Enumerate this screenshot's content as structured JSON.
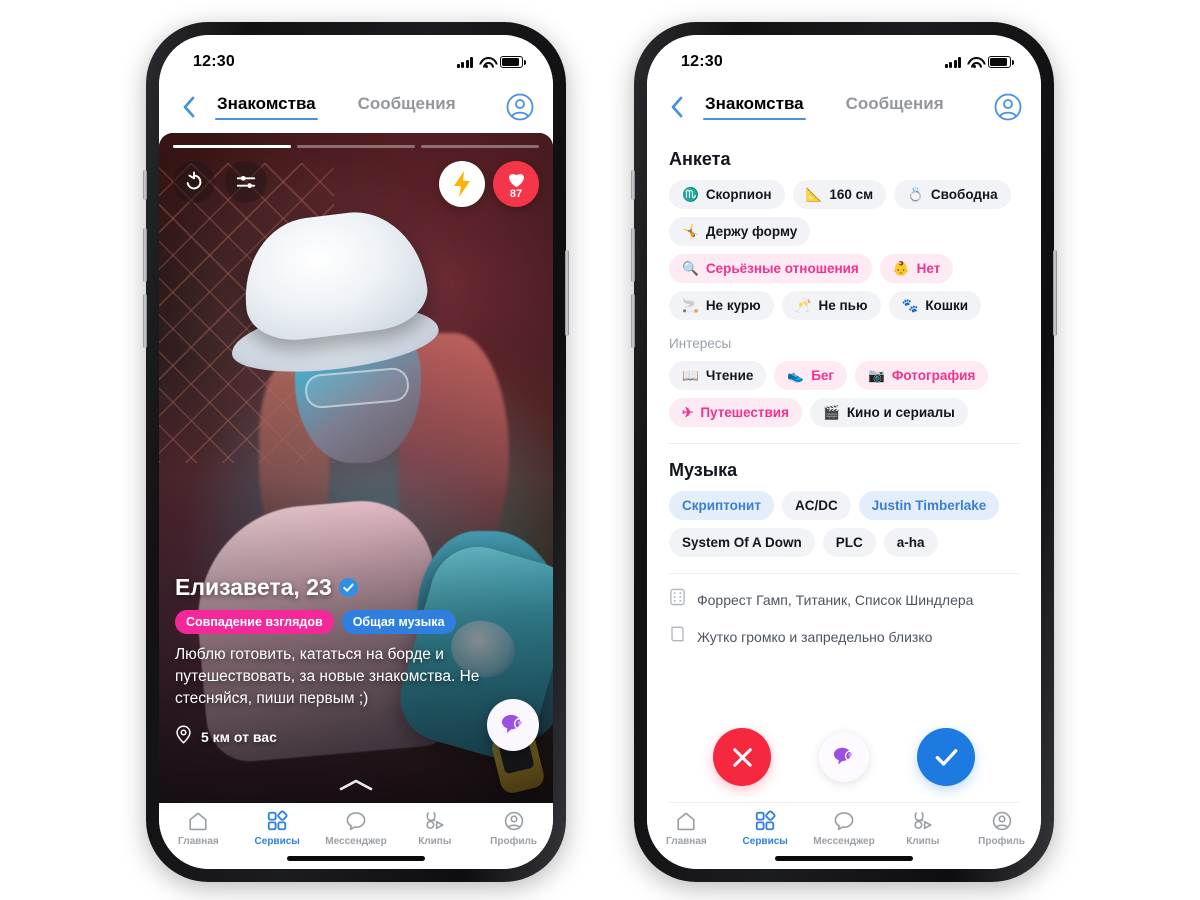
{
  "status": {
    "time": "12:30",
    "signal_icon": "cellular-signal-icon",
    "wifi_icon": "wifi-icon",
    "battery_icon": "battery-icon"
  },
  "nav": {
    "back_icon": "back-chevron-icon",
    "tab_dating": "Знакомства",
    "tab_messages": "Сообщения",
    "profile_icon": "account-circle-icon"
  },
  "card": {
    "progress_total": 3,
    "progress_active": 1,
    "rewind_icon": "rewind-arrow-icon",
    "filters_icon": "sliders-icon",
    "boost_icon": "lightning-bolt-icon",
    "likes_icon": "heart-icon",
    "likes_count": "87",
    "name": "Елизавета, 23",
    "verified_icon": "verified-check-icon",
    "badge_views": "Совпадение взглядов",
    "badge_music": "Общая музыка",
    "bio": "Люблю готовить, кататься на борде и путешествовать, за новые знакомства. Не стесняйся, пиши первым ;)",
    "location_icon": "location-pin-icon",
    "distance": "5 км от вас",
    "chat_fab_icon": "chat-heart-icon",
    "expand_icon": "chevron-up-icon"
  },
  "tabbar": {
    "items": [
      {
        "label": "Главная",
        "icon": "home-icon",
        "active": false
      },
      {
        "label": "Сервисы",
        "icon": "services-icon",
        "active": true
      },
      {
        "label": "Мессенджер",
        "icon": "chat-bubble-icon",
        "active": false
      },
      {
        "label": "Клипы",
        "icon": "clips-icon",
        "active": false
      },
      {
        "label": "Профиль",
        "icon": "profile-icon",
        "active": false
      }
    ]
  },
  "detail": {
    "profile_title": "Анкета",
    "profile_chips": [
      {
        "emoji": "♏",
        "label": "Скорпион",
        "style": "plain"
      },
      {
        "emoji": "📐",
        "label": "160 см",
        "style": "plain"
      },
      {
        "emoji": "💍",
        "label": "Свободна",
        "style": "plain"
      },
      {
        "emoji": "🤸",
        "label": "Держу форму",
        "style": "plain"
      },
      {
        "emoji": "🔍",
        "label": "Серьёзные отношения",
        "style": "match"
      },
      {
        "emoji": "👶",
        "label": "Нет",
        "style": "match"
      },
      {
        "emoji": "🚬",
        "label": "Не курю",
        "style": "plain"
      },
      {
        "emoji": "🥂",
        "label": "Не пью",
        "style": "plain"
      },
      {
        "emoji": "🐾",
        "label": "Кошки",
        "style": "plain"
      }
    ],
    "interests_title": "Интересы",
    "interest_chips": [
      {
        "emoji": "📖",
        "label": "Чтение",
        "style": "plain"
      },
      {
        "emoji": "👟",
        "label": "Бег",
        "style": "match"
      },
      {
        "emoji": "📷",
        "label": "Фотография",
        "style": "match"
      },
      {
        "emoji": "✈",
        "label": "Путешествия",
        "style": "match"
      },
      {
        "emoji": "🎬",
        "label": "Кино и сериалы",
        "style": "plain"
      }
    ],
    "music_title": "Музыка",
    "music_chips": [
      {
        "label": "Скриптонит",
        "style": "blue"
      },
      {
        "label": "AC/DC",
        "style": "plain"
      },
      {
        "label": "Justin Timberlake",
        "style": "blue"
      },
      {
        "label": "System Of A Down",
        "style": "plain"
      },
      {
        "label": "PLC",
        "style": "plain"
      },
      {
        "label": "a-ha",
        "style": "plain"
      }
    ],
    "films_icon": "film-reel-icon",
    "films": "Форрест Гамп, Титаник, Список Шиндлера",
    "books_icon": "book-icon",
    "books": "Жутко громко и запредельно близко",
    "action_dislike_icon": "cross-icon",
    "action_message_icon": "chat-heart-icon",
    "action_like_icon": "check-icon"
  },
  "colors": {
    "accent_blue": "#2f7fe0",
    "pink": "#f5289a",
    "match_pink": "#f0338e",
    "like_blue": "#1d7ae0",
    "dislike_red": "#f5283f"
  }
}
